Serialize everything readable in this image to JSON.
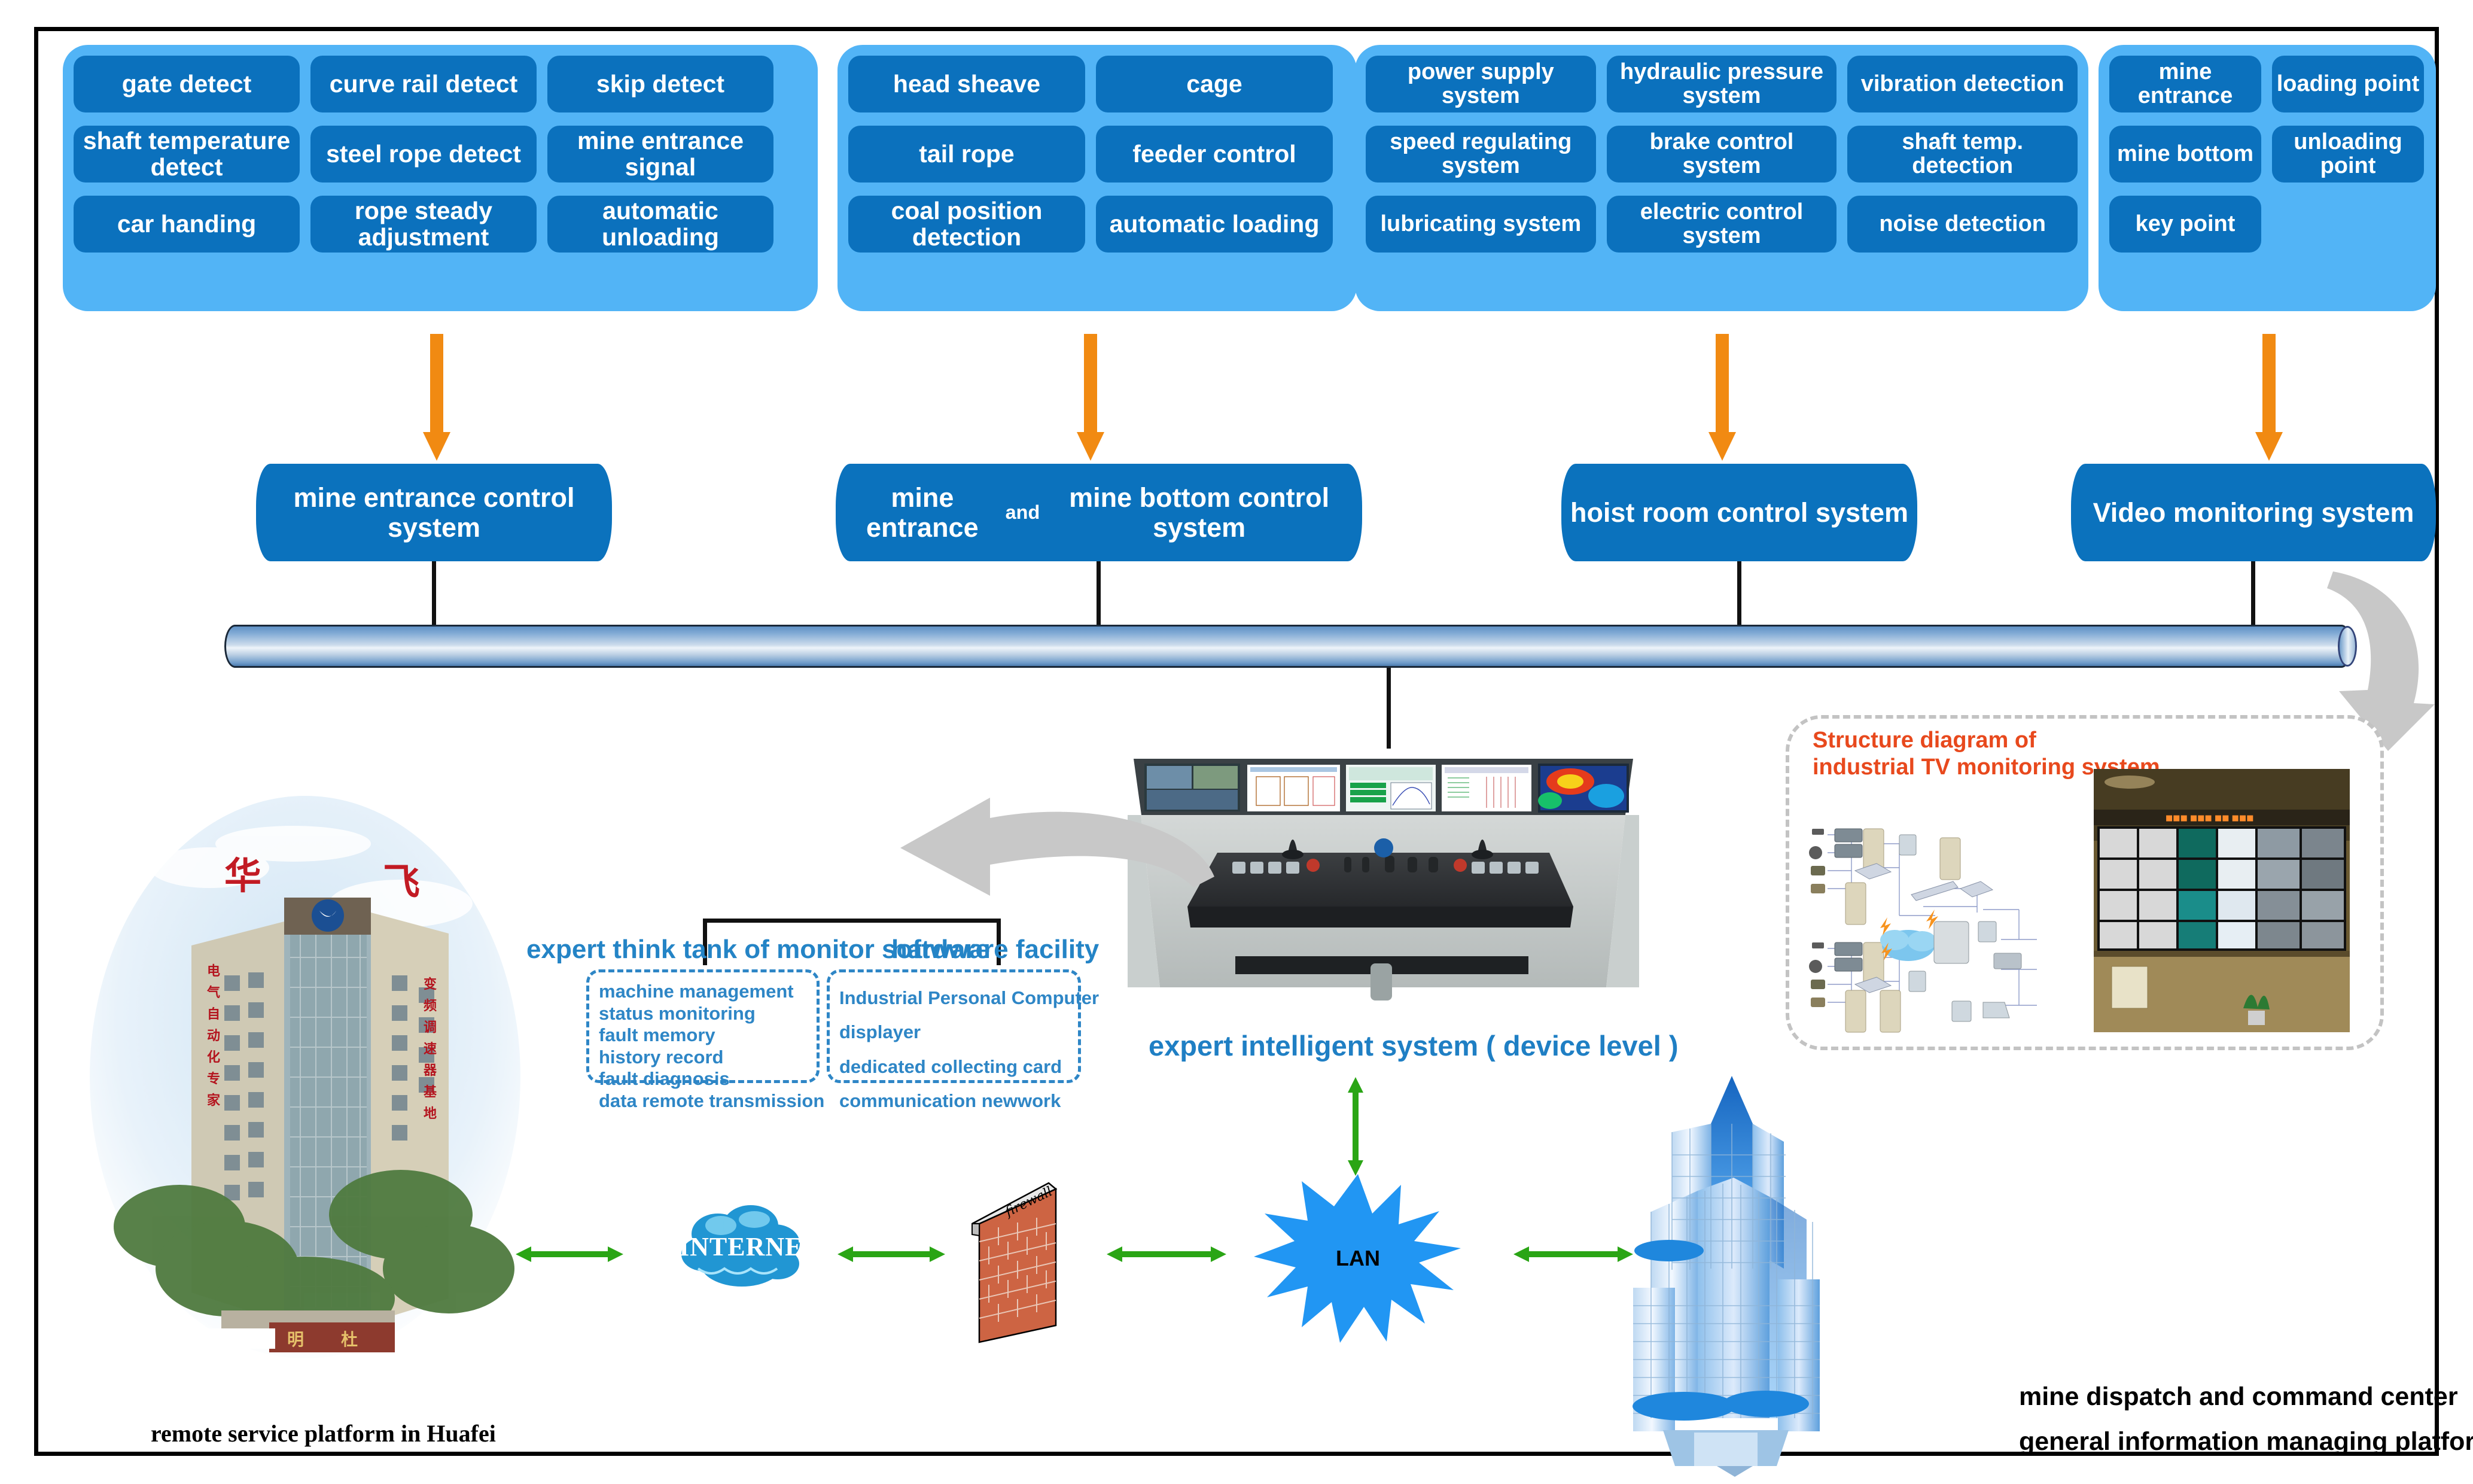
{
  "groups": [
    {
      "name": "mine-entrance-sensors",
      "rows": [
        [
          "gate  detect",
          "curve rail  detect",
          "skip detect"
        ],
        [
          "shaft temperature detect",
          "steel rope detect",
          "mine entrance signal"
        ],
        [
          "car handing",
          "rope steady adjustment",
          "automatic unloading"
        ]
      ]
    },
    {
      "name": "mine-bottom-sensors",
      "rows": [
        [
          "head sheave",
          "cage"
        ],
        [
          "tail rope",
          "feeder control"
        ],
        [
          "coal position detection",
          "automatic loading"
        ]
      ]
    },
    {
      "name": "hoist-room-sensors",
      "rows": [
        [
          "power supply system",
          "hydraulic pressure system",
          "vibration detection"
        ],
        [
          "speed regulating system",
          "brake control system",
          "shaft temp. detection"
        ],
        [
          "lubricating system",
          "electric control system",
          "noise detection"
        ]
      ]
    },
    {
      "name": "video-monitoring-points",
      "rows": [
        [
          "mine entrance",
          "loading point"
        ],
        [
          "mine bottom",
          "unloading point"
        ],
        [
          "key  point"
        ]
      ]
    }
  ],
  "control_systems": [
    {
      "label": "mine entrance control system"
    },
    {
      "label_pre": "mine entrance",
      "label_mid": "and",
      "label_post": "mine bottom control system"
    },
    {
      "label": "hoist room control system"
    },
    {
      "label": "Video monitoring system"
    }
  ],
  "middle": {
    "software_header": "expert think tank of monitor software",
    "hardware_header": "hardware facility",
    "software_items": [
      "machine management",
      "status monitoring",
      "fault memory",
      "history record",
      "fault diagnosis",
      "data remote transmission"
    ],
    "hardware_items": [
      "Industrial Personal Computer",
      "displayer",
      "dedicated collecting card",
      "communication newwork"
    ],
    "console_caption": "expert intelligent system ( device level )"
  },
  "tv_panel": {
    "title_line1": "Structure diagram of",
    "title_line2": "industrial TV monitoring system"
  },
  "network": {
    "internet_label": "INTERNET",
    "firewall_label": "firewall",
    "lan_label": "LAN"
  },
  "captions": {
    "left_photo": "remote service platform in Huafei",
    "right_line1": "mine dispatch and command center",
    "right_line2": "general information managing platform"
  },
  "colors": {
    "group_panel": "#52b4f6",
    "chip": "#0b71bd",
    "control_box": "#0b72bd",
    "orange_arrow": "#f18a12",
    "green_arrow": "#2aa515",
    "blue_text": "#2484c6",
    "tv_title": "#e8491d",
    "lan_star": "#2196f3"
  }
}
